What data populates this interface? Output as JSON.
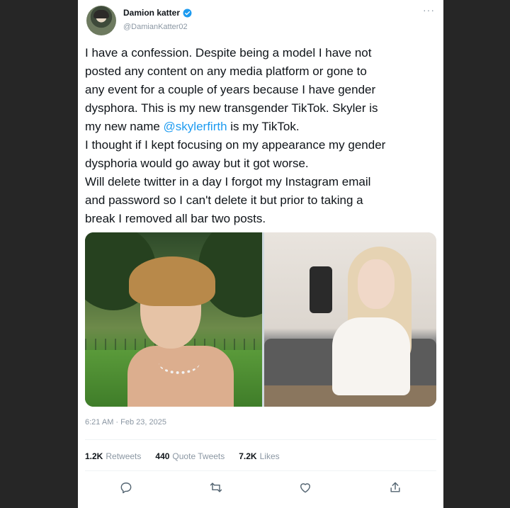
{
  "tweet": {
    "author": {
      "display_name": "Damion katter",
      "handle": "@DamianKatter02",
      "verified": true,
      "avatar_icon": "user-avatar"
    },
    "more_icon": "more-icon",
    "text": {
      "line1": "I have a confession. Despite being a model I have not",
      "line2": "posted any content on any media platform or gone to",
      "line3": "any event for a couple of years because I have gender",
      "line4": "dysphora. This is my new transgender TikTok. Skyler is",
      "line5_before": "my new name ",
      "line5_mention": "@skylerfirth",
      "line5_after": " is my TikTok.",
      "line6": "I thought if I kept focusing on my appearance my gender",
      "line7": "dysphoria would go away but it got worse.",
      "line8": "Will delete twitter in a day I forgot my Instagram email",
      "line9": "and password so I can't delete it but prior to taking a",
      "line10": "break I removed all bar two posts."
    },
    "timestamp": "6:21 AM · Feb 23, 2025",
    "stats": {
      "retweets_count": "1.2K",
      "retweets_label": "Retweets",
      "quotes_count": "440",
      "quotes_label": "Quote Tweets",
      "likes_count": "7.2K",
      "likes_label": "Likes"
    },
    "actions": [
      "reply-icon",
      "retweet-icon",
      "like-icon",
      "share-icon"
    ],
    "colors": {
      "link": "#1d9bf0",
      "text": "#0f1419",
      "muted": "#8b97a3"
    }
  }
}
